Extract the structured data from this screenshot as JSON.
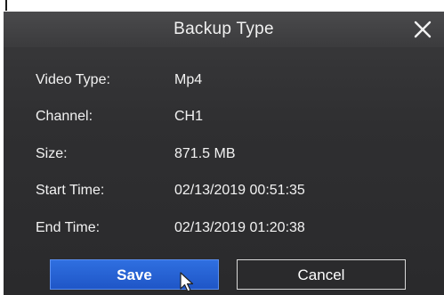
{
  "dialog": {
    "title": "Backup Type",
    "close_icon": "close-icon",
    "fields": [
      {
        "label": "Video Type:",
        "value": "Mp4"
      },
      {
        "label": "Channel:",
        "value": "CH1"
      },
      {
        "label": "Size:",
        "value": "871.5 MB"
      },
      {
        "label": "Start Time:",
        "value": "02/13/2019 00:51:35"
      },
      {
        "label": "End Time:",
        "value": "02/13/2019 01:20:38"
      }
    ],
    "buttons": {
      "save_label": "Save",
      "cancel_label": "Cancel"
    }
  },
  "colors": {
    "dialog_bg": "#2f2f31",
    "titlebar_bg": "#3b3b3d",
    "text": "#f2f2f2",
    "save_button": "#1f56c7"
  }
}
